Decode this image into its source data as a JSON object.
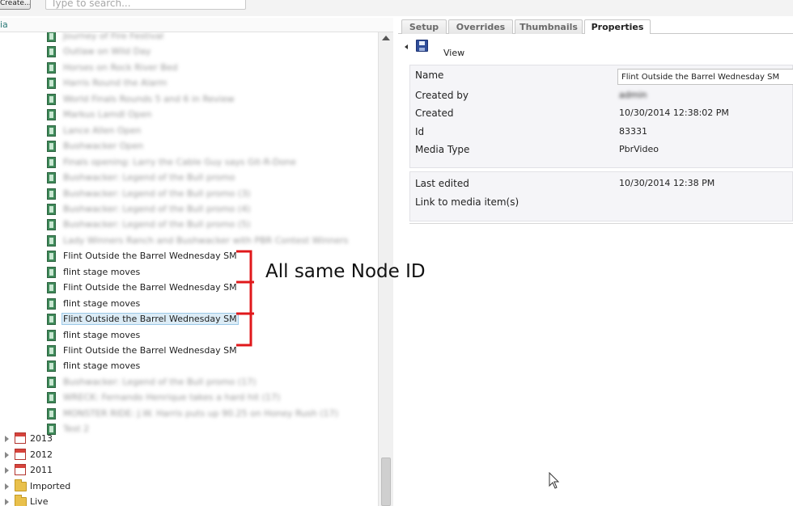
{
  "toolbar": {
    "create_label": "Create...",
    "search_placeholder": "Type to search..."
  },
  "left_pane": {
    "header_label": "ia",
    "items": [
      {
        "label": "Journey of Fire Festival",
        "blurred": true
      },
      {
        "label": "Outlaw on Wild Day",
        "blurred": true
      },
      {
        "label": "Horses on Rock River Bed",
        "blurred": true
      },
      {
        "label": "Harris Round the Alarm",
        "blurred": true
      },
      {
        "label": "World Finals Rounds 5 and 6 in Review",
        "blurred": true
      },
      {
        "label": "Markus Lamdl Open",
        "blurred": true
      },
      {
        "label": "Lance Allen Open",
        "blurred": true
      },
      {
        "label": "Bushwacker Open",
        "blurred": true
      },
      {
        "label": "Finals opening: Larry the Cable Guy says Git-R-Done",
        "blurred": true
      },
      {
        "label": "Bushwacker: Legend of the Bull promo",
        "blurred": true
      },
      {
        "label": "Bushwacker: Legend of the Bull promo (3)",
        "blurred": true
      },
      {
        "label": "Bushwacker: Legend of the Bull promo (4)",
        "blurred": true
      },
      {
        "label": "Bushwacker: Legend of the Bull promo (5)",
        "blurred": true
      },
      {
        "label": "Lady Winners Ranch and Bushwacker with PBR Contest Winners",
        "blurred": true
      },
      {
        "label": "Flint Outside the Barrel Wednesday SM",
        "blurred": false,
        "selected": false
      },
      {
        "label": "flint stage moves",
        "blurred": false,
        "selected": false
      },
      {
        "label": "Flint Outside the Barrel Wednesday SM",
        "blurred": false,
        "selected": false
      },
      {
        "label": "flint stage moves",
        "blurred": false,
        "selected": false
      },
      {
        "label": "Flint Outside the Barrel Wednesday SM",
        "blurred": false,
        "selected": true
      },
      {
        "label": "flint stage moves",
        "blurred": false,
        "selected": false
      },
      {
        "label": "Flint Outside the Barrel Wednesday SM",
        "blurred": false,
        "selected": false
      },
      {
        "label": "flint stage moves",
        "blurred": false,
        "selected": false
      },
      {
        "label": "Bushwacker: Legend of the Bull promo (17)",
        "blurred": true
      },
      {
        "label": "WRECK: Fernando Henrique takes a hard hit (17)",
        "blurred": true
      },
      {
        "label": "MONSTER RIDE: J.W. Harris puts up 90.25 on Honey Rush (17)",
        "blurred": true
      },
      {
        "label": "Test 2",
        "blurred": true
      }
    ],
    "folders": [
      {
        "label": "2013",
        "icon": "calendar-icon"
      },
      {
        "label": "2012",
        "icon": "calendar-icon"
      },
      {
        "label": "2011",
        "icon": "calendar-icon"
      },
      {
        "label": "Imported",
        "icon": "folder-icon"
      },
      {
        "label": "Live",
        "icon": "folder-icon"
      }
    ]
  },
  "annotation": {
    "text": "All same Node ID",
    "color": "#e0181b"
  },
  "tabs": [
    {
      "label": "Setup",
      "active": false
    },
    {
      "label": "Overrides",
      "active": false
    },
    {
      "label": "Thumbnails",
      "active": false
    },
    {
      "label": "Properties",
      "active": true
    }
  ],
  "view_label": "View",
  "properties": {
    "name_label": "Name",
    "name_value": "Flint Outside the Barrel Wednesday SM",
    "created_by_label": "Created by",
    "created_by_value": "admin",
    "created_label": "Created",
    "created_value": "10/30/2014 12:38:02 PM",
    "id_label": "Id",
    "id_value": "83331",
    "media_type_label": "Media Type",
    "media_type_value": "PbrVideo",
    "last_edited_label": "Last edited",
    "last_edited_value": "10/30/2014 12:38 PM",
    "link_label": "Link to media item(s)"
  }
}
